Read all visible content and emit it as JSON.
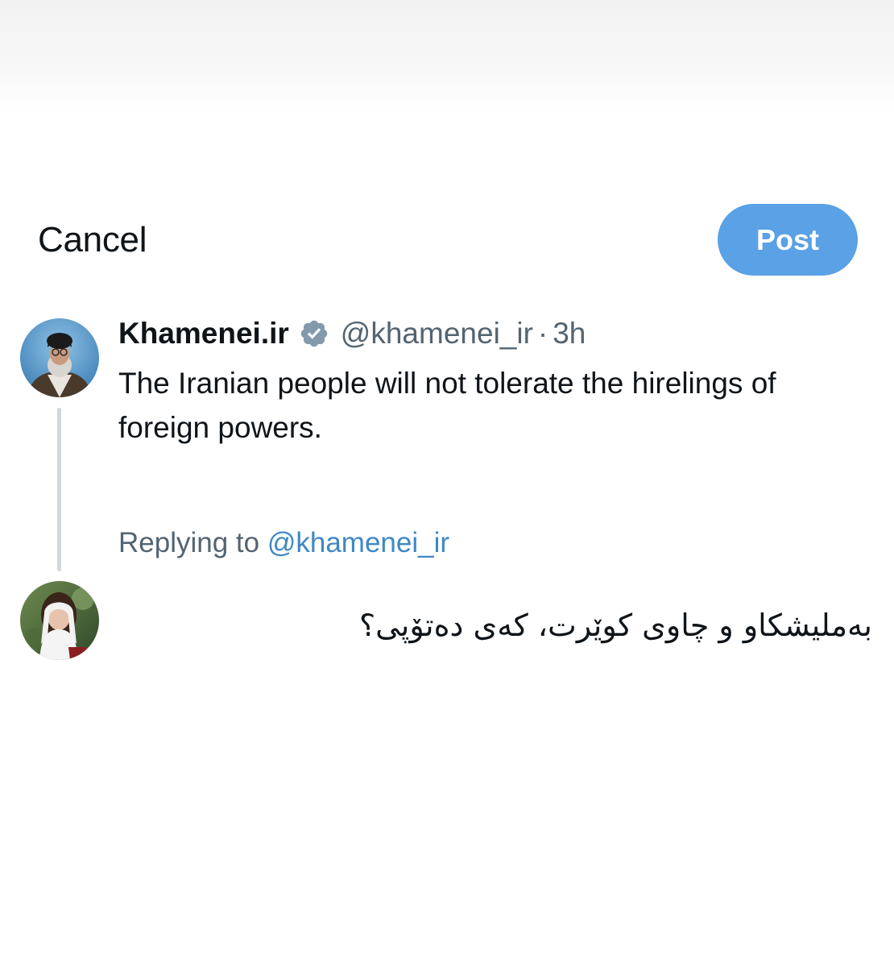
{
  "compose": {
    "cancel_label": "Cancel",
    "post_label": "Post",
    "accent_color": "#5aa1e6"
  },
  "original_tweet": {
    "author_name": "Khamenei.ir",
    "verified": true,
    "verified_icon": "verified-badge-icon",
    "handle": "@khamenei_ir",
    "separator": "·",
    "time": "3h",
    "text": "The Iranian people will not tolerate the hirelings of foreign powers.",
    "avatar_icon": "profile-photo"
  },
  "reply": {
    "replying_to_prefix": "Replying to",
    "replying_to_handle": "@khamenei_ir",
    "draft_text": "بەملیشکاو و چاوی کوێرت، کەی دەتۆپی؟",
    "avatar_icon": "profile-photo"
  }
}
